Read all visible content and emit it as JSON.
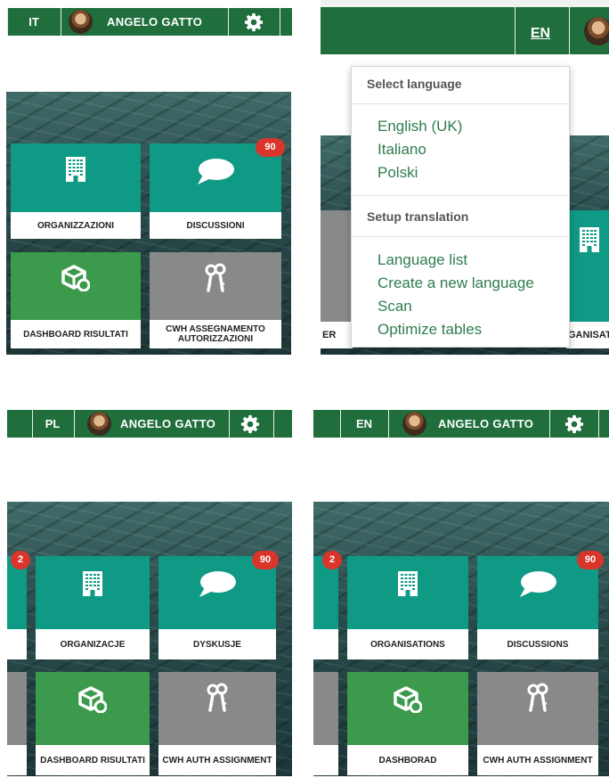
{
  "user": {
    "name": "ANGELO GATTO"
  },
  "panels": {
    "it": {
      "lang": "IT",
      "tiles": [
        {
          "label": "ORGANIZZAZIONI",
          "icon": "building-icon"
        },
        {
          "label": "DISCUSSIONI",
          "icon": "chat-bubble-icon",
          "badge": "90"
        },
        {
          "label": "DASHBOARD RISULTATI",
          "icon": "box-settings-icon"
        },
        {
          "label": "CWH ASSEGNAMENTO AUTORIZZAZIONI",
          "icon": "keys-icon"
        }
      ]
    },
    "dropdown": {
      "lang": "EN",
      "select_heading": "Select language",
      "languages": [
        "English (UK)",
        "Italiano",
        "Polski"
      ],
      "setup_heading": "Setup translation",
      "setup_items": [
        "Language list",
        "Create a new language",
        "Scan",
        "Optimize tables"
      ],
      "peek_left": "ER",
      "peek_right": "GANISAT"
    },
    "pl": {
      "lang": "PL",
      "left_badge": "2",
      "tiles": [
        {
          "label": "ORGANIZACJE",
          "icon": "building-icon"
        },
        {
          "label": "DYSKUSJE",
          "icon": "chat-bubble-icon",
          "badge": "90"
        },
        {
          "label": "DASHBOARD RISULTATI",
          "icon": "box-settings-icon"
        },
        {
          "label": "CWH AUTH ASSIGNMENT",
          "icon": "keys-icon"
        }
      ]
    },
    "en": {
      "lang": "EN",
      "left_badge": "2",
      "tiles": [
        {
          "label": "ORGANISATIONS",
          "icon": "building-icon"
        },
        {
          "label": "DISCUSSIONS",
          "icon": "chat-bubble-icon",
          "badge": "90"
        },
        {
          "label": "DASHBORAD",
          "icon": "box-settings-icon"
        },
        {
          "label": "CWH AUTH ASSIGNMENT",
          "icon": "keys-icon"
        }
      ]
    }
  },
  "colors": {
    "header_green": "#1f6e3c",
    "tile_teal": "#0f9a86",
    "tile_green": "#3b9a4b",
    "tile_grey": "#878a89",
    "badge_red": "#d9352b",
    "link_green": "#2f7d4e"
  }
}
